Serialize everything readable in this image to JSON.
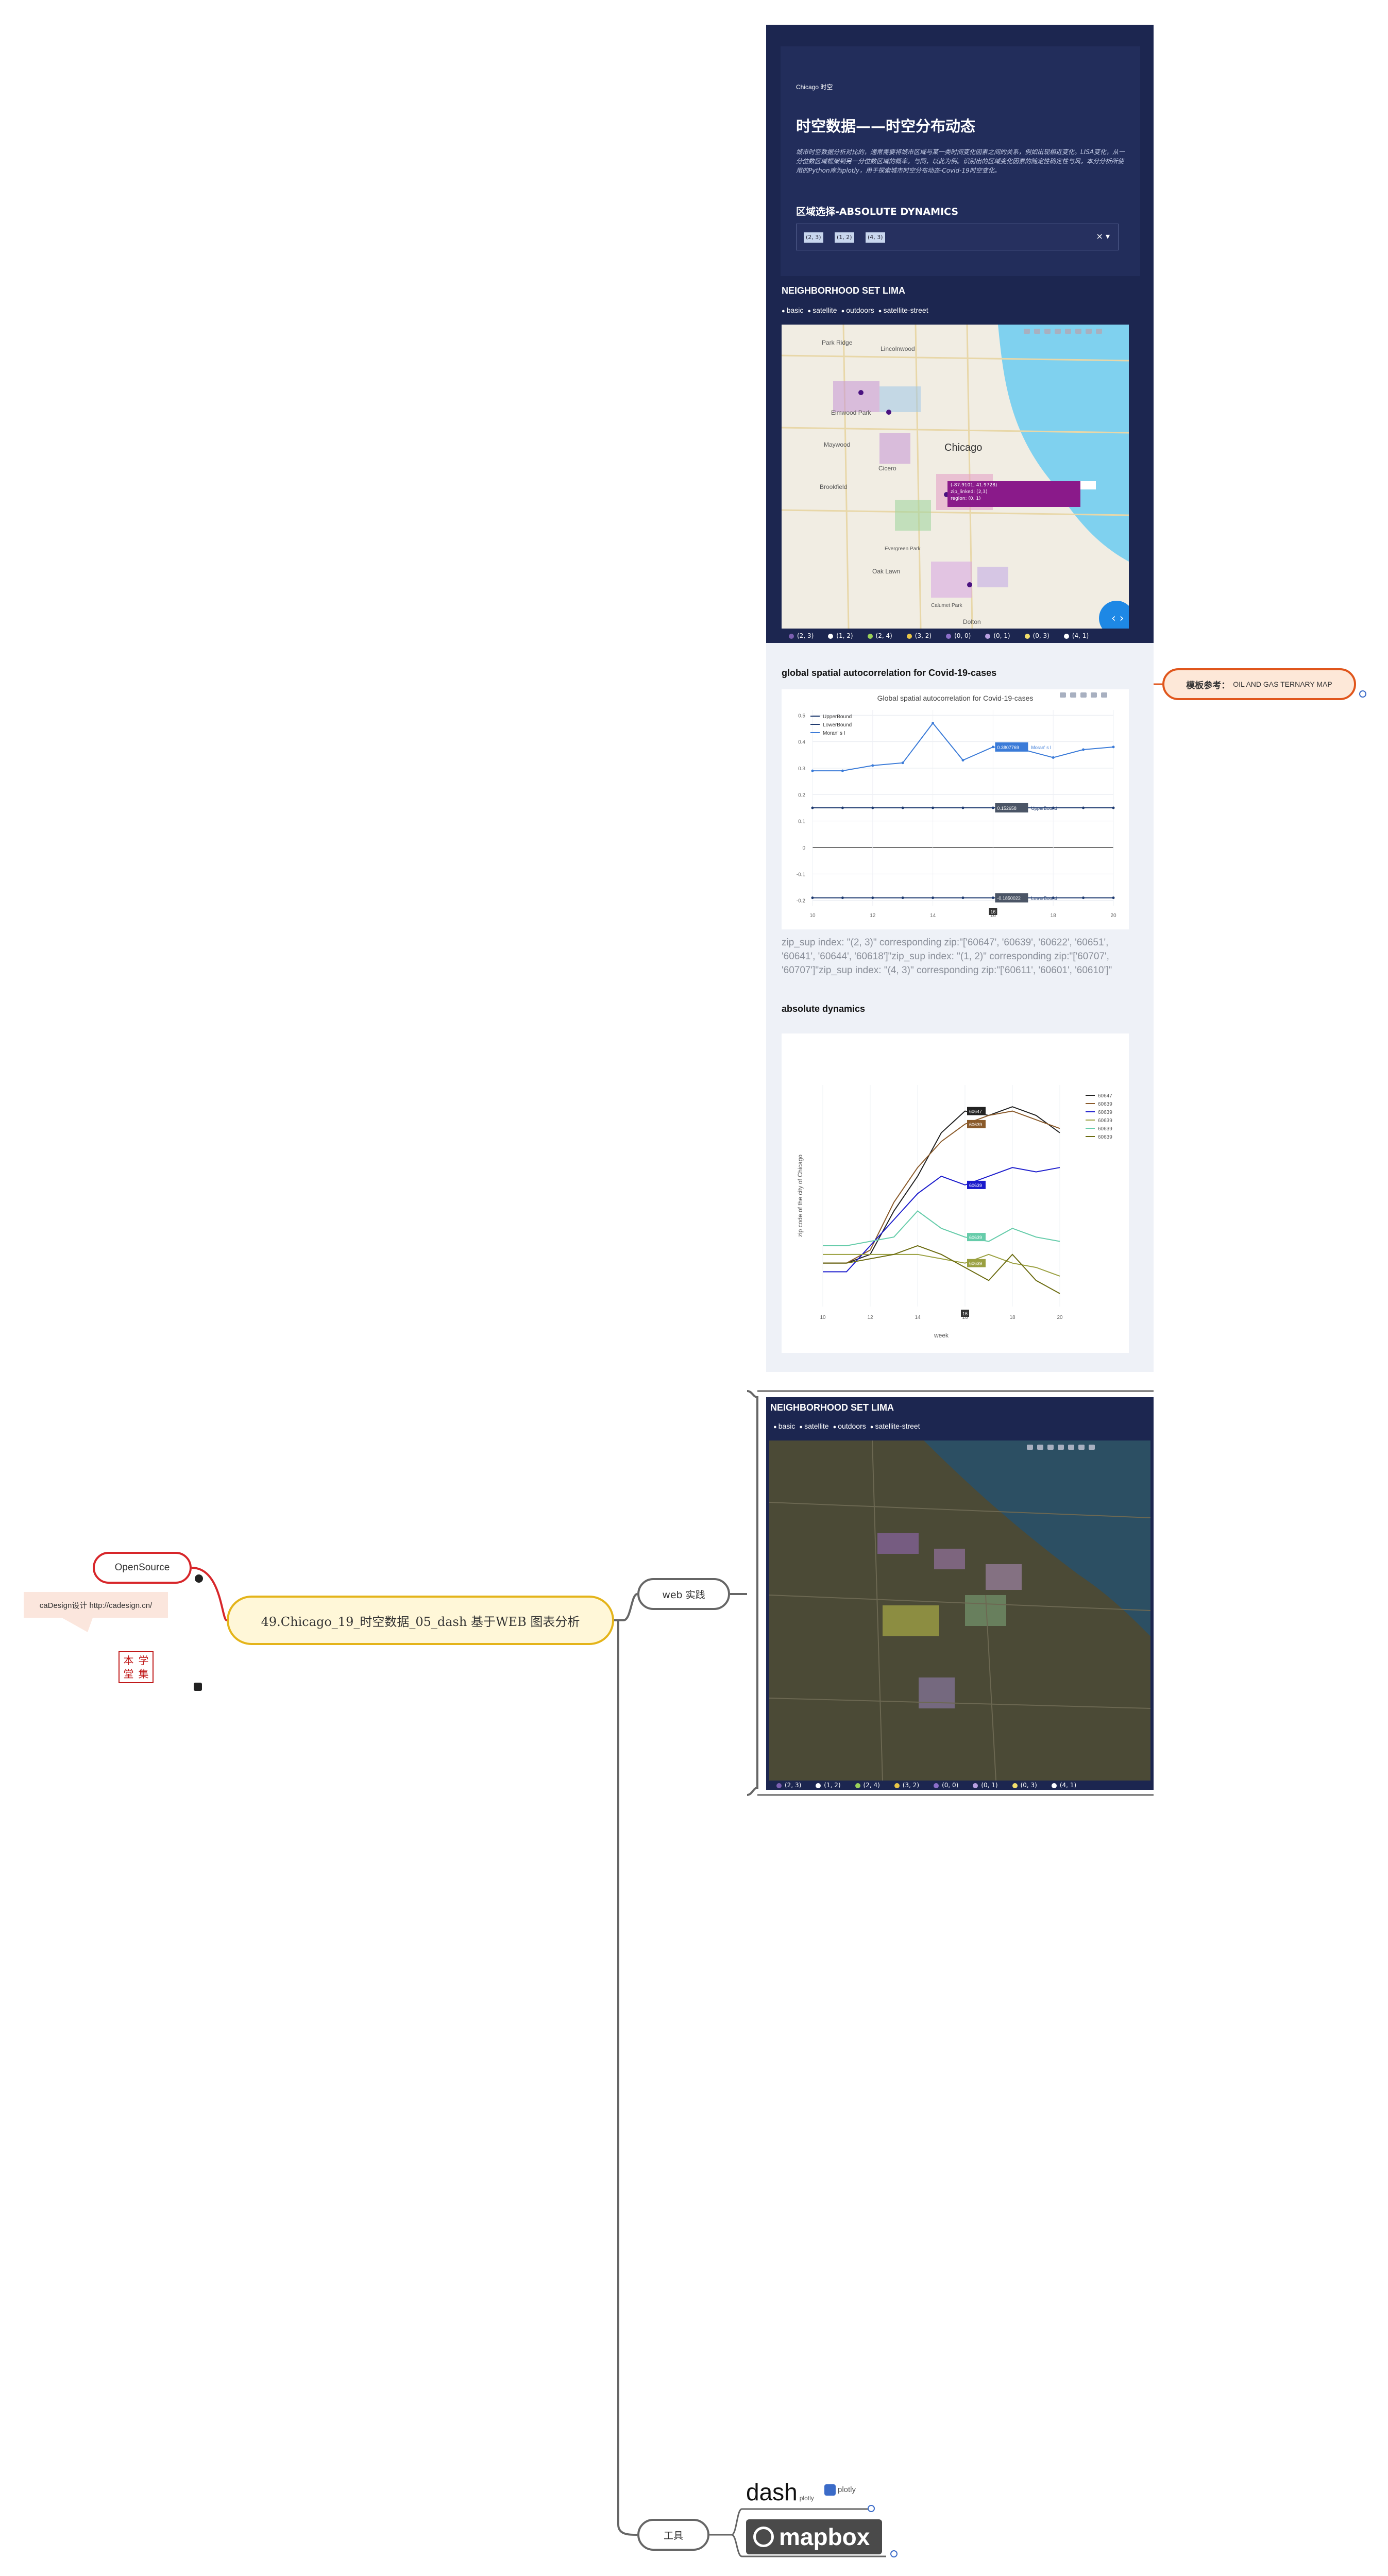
{
  "mindmap": {
    "main_topic": "49.Chicago_19_时空数据_05_dash 基于WEB 图表分析",
    "open_source_label": "OpenSource",
    "callout_text": "caDesign设计 http://cadesign.cn/",
    "seal_chars": [
      "本",
      "学",
      "堂",
      "集"
    ],
    "web_label": "web 实践",
    "tools_label": "工具",
    "ref_label_bold": "模板参考：",
    "ref_label_text": "OIL AND GAS TERNARY MAP"
  },
  "dashboard": {
    "brand": "Chicago 时空",
    "title": "时空数据——时空分布动态",
    "intro": "城市时空数据分析对比的，通常需要将城市区域与某一类时间变化因素之间的关系，例如出现相近变化。LISA变化，从一分位数区域框架到另一分位数区域的概率。与同，以此为例。识别出的区域变化因素的随定性确定性与风，本分分析所使用的Python库为plotly，用于探索城市时空分布动态-Covid-19时空变化。",
    "region_select_title": "区域选择-ABSOLUTE DYNAMICS",
    "region_chips": [
      "(2, 3)",
      "(1, 2)",
      "(4, 3)"
    ],
    "neighborhood_title": "NEIGHBORHOOD SET LIMA",
    "map_styles": [
      "basic",
      "satellite",
      "outdoors",
      "satellite-street"
    ],
    "map_place_labels": [
      "Park Ridge",
      "Lincolnwood",
      "Elmwood Park",
      "Maywood",
      "Cicero",
      "Chicago",
      "Brookfield",
      "Oak Lawn",
      "Dolton",
      "Calumet Park",
      "Evergreen Park"
    ],
    "map_tooltip": [
      "(-87.9101, 41.9728)",
      "zip_linked: (2,3)",
      "region: (0, 1)"
    ],
    "legend_items": [
      "(2, 3)",
      "(1, 2)",
      "(2, 4)",
      "(3, 2)",
      "(0, 0)",
      "(0, 1)",
      "(0, 3)",
      "(4, 1)"
    ],
    "legend_colors": [
      "#7b5fb0",
      "#ffffff",
      "#9bd15a",
      "#e8c547",
      "#8c6ec9",
      "#b89fe0",
      "#f2de6c",
      "#ffffff"
    ],
    "autocorr_title": "global spatial autocorrelation for Covid-19-cases",
    "zip_text": "zip_sup index: \"(2, 3)\" corresponding zip:\"['60647', '60639', '60622', '60651', '60641', '60644', '60618']\"zip_sup index: \"(1, 2)\" corresponding zip:\"['60707', '60707']\"zip_sup index: \"(4, 3)\" corresponding zip:\"['60611', '60601', '60610']\"",
    "absolute_title": "absolute dynamics",
    "satellite_title": "NEIGHBORHOOD SET LIMA",
    "satellite_legend": [
      "(2, 3)",
      "(1, 2)",
      "(2, 4)",
      "(3, 2)",
      "(0, 0)",
      "(0, 1)",
      "(0, 3)",
      "(4, 1)"
    ]
  },
  "chart_data": [
    {
      "type": "line",
      "title": "Global spatial autocorrelation for Covid-19-cases",
      "xlabel": "",
      "ylabel": "",
      "x": [
        10,
        11,
        12,
        13,
        14,
        15,
        16,
        17,
        18,
        19,
        20
      ],
      "xticks": [
        10,
        12,
        14,
        16,
        18,
        20
      ],
      "yticks": [
        -0.2,
        -0.1,
        0,
        0.1,
        0.2,
        0.3,
        0.4,
        0.5
      ],
      "ylim": [
        -0.22,
        0.52
      ],
      "series": [
        {
          "name": "UpperBound",
          "values": [
            0.15,
            0.15,
            0.15,
            0.15,
            0.15,
            0.15,
            0.15,
            0.15,
            0.15,
            0.15,
            0.15
          ],
          "color": "#1f3b70"
        },
        {
          "name": "LowerBound",
          "values": [
            -0.19,
            -0.19,
            -0.19,
            -0.19,
            -0.19,
            -0.19,
            -0.19,
            -0.19,
            -0.19,
            -0.19,
            -0.19
          ],
          "color": "#1f3b70"
        },
        {
          "name": "Moran' s I",
          "values": [
            0.29,
            0.29,
            0.31,
            0.32,
            0.47,
            0.33,
            0.38,
            0.37,
            0.34,
            0.37,
            0.38
          ],
          "color": "#3b7bd8"
        }
      ],
      "hover_labels": [
        "0.3807769",
        "0.152658",
        "-0.1850022"
      ],
      "hover_x": 16
    },
    {
      "type": "line",
      "title": "",
      "xlabel": "week",
      "ylabel": "zip code of the city of Chicago",
      "x": [
        10,
        11,
        12,
        13,
        14,
        15,
        16,
        17,
        18,
        19,
        20
      ],
      "xticks": [
        10,
        12,
        14,
        16,
        18,
        20
      ],
      "series": [
        {
          "name": "60647",
          "values": [
            10,
            10,
            12,
            22,
            30,
            40,
            45,
            44,
            46,
            44,
            40
          ],
          "color": "#222222"
        },
        {
          "name": "60639",
          "values": [
            10,
            10,
            13,
            24,
            32,
            38,
            42,
            44,
            45,
            43,
            41
          ],
          "color": "#8a5a2a"
        },
        {
          "name": "60639",
          "values": [
            8,
            8,
            14,
            20,
            26,
            30,
            28,
            30,
            32,
            31,
            32
          ],
          "color": "#1a1acc"
        },
        {
          "name": "60639",
          "values": [
            12,
            12,
            12,
            12,
            12,
            11,
            10,
            12,
            10,
            9,
            7
          ],
          "color": "#9aa040"
        },
        {
          "name": "60639",
          "values": [
            14,
            14,
            15,
            16,
            22,
            18,
            16,
            15,
            18,
            16,
            15
          ],
          "color": "#66ccaa"
        },
        {
          "name": "60639",
          "values": [
            10,
            10,
            11,
            12,
            14,
            12,
            9,
            6,
            12,
            6,
            3
          ],
          "color": "#6b6b10"
        }
      ],
      "hover_labels": [
        "60647",
        "60639",
        "60639",
        "60639",
        "60639"
      ],
      "hover_x": 16
    }
  ],
  "tools": {
    "dash_label": "dash",
    "dash_sub": "plotly",
    "plotly_label": "plotly",
    "mapbox_label": "mapbox"
  }
}
